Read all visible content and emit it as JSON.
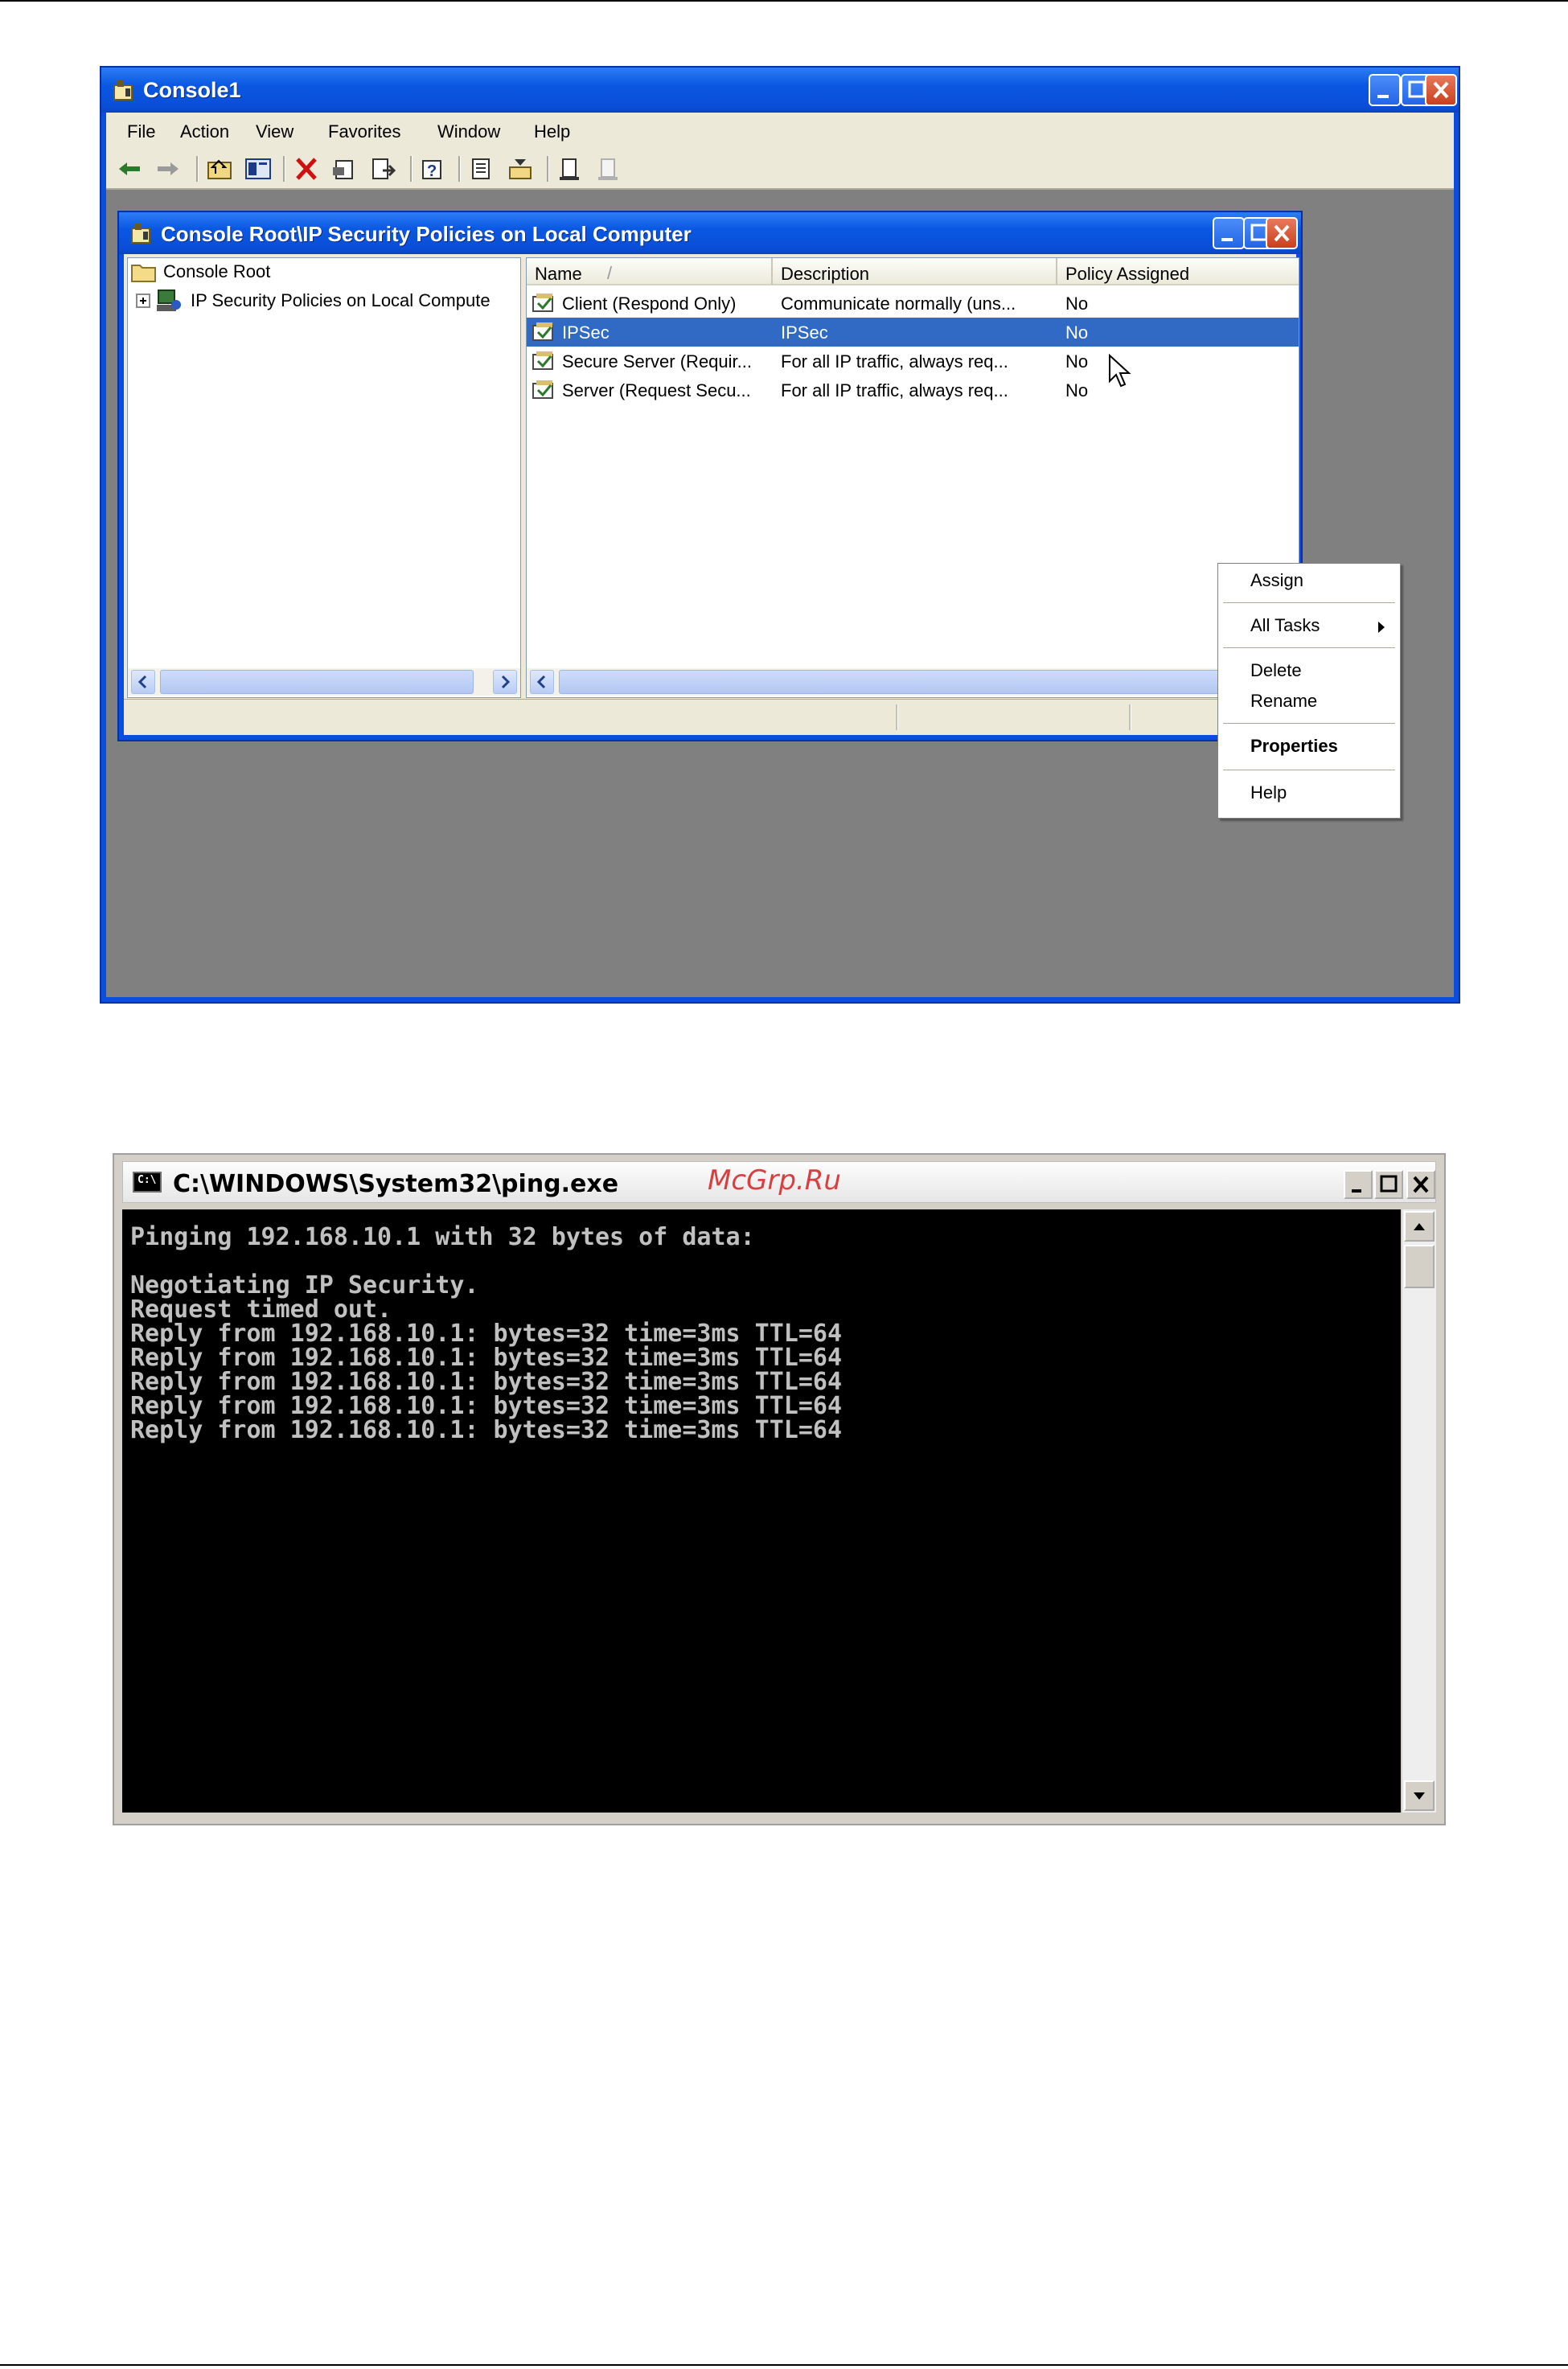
{
  "mmc": {
    "title": "Console1",
    "menu": [
      "File",
      "Action",
      "View",
      "Favorites",
      "Window",
      "Help"
    ],
    "toolbar_icons": [
      "back-arrow-icon",
      "forward-arrow-icon",
      "up-folder-icon",
      "show-hide-tree-icon",
      "delete-icon",
      "properties-icon",
      "export-list-icon",
      "help-icon",
      "new-policy-icon",
      "manage-filters-icon",
      "assign-icon",
      "unassign-icon"
    ],
    "child": {
      "title": "Console Root\\IP Security Policies on Local Computer",
      "tree": {
        "root": "Console Root",
        "child": "IP Security Policies on Local Compute"
      },
      "columns": {
        "name": "Name",
        "sort_glyph": "/",
        "description": "Description",
        "policy_assigned": "Policy Assigned"
      },
      "rows": [
        {
          "name": "Client (Respond Only)",
          "description": "Communicate normally (uns...",
          "assigned": "No",
          "selected": false
        },
        {
          "name": "IPSec",
          "description": "IPSec",
          "assigned": "No",
          "selected": true
        },
        {
          "name": "Secure Server (Requir...",
          "description": "For all IP traffic, always req...",
          "assigned": "No",
          "selected": false
        },
        {
          "name": "Server (Request Secu...",
          "description": "For all IP traffic, always req...",
          "assigned": "No",
          "selected": false
        }
      ]
    },
    "context_menu": {
      "assign": "Assign",
      "all_tasks": "All Tasks",
      "delete": "Delete",
      "rename": "Rename",
      "properties": "Properties",
      "help": "Help"
    }
  },
  "cmd": {
    "title": "C:\\WINDOWS\\System32\\ping.exe",
    "watermark": "McGrp.Ru",
    "icon_text": "C:\\",
    "lines": [
      "Pinging 192.168.10.1 with 32 bytes of data:",
      "",
      "Negotiating IP Security.",
      "Request timed out.",
      "Reply from 192.168.10.1: bytes=32 time=3ms TTL=64",
      "Reply from 192.168.10.1: bytes=32 time=3ms TTL=64",
      "Reply from 192.168.10.1: bytes=32 time=3ms TTL=64",
      "Reply from 192.168.10.1: bytes=32 time=3ms TTL=64",
      "Reply from 192.168.10.1: bytes=32 time=3ms TTL=64"
    ]
  },
  "colors": {
    "xp_title_blue": "#0a58e2",
    "selection_blue": "#316ac5",
    "console_bg": "#000000",
    "console_text": "#c0c0c0",
    "watermark_red": "#d84040"
  }
}
